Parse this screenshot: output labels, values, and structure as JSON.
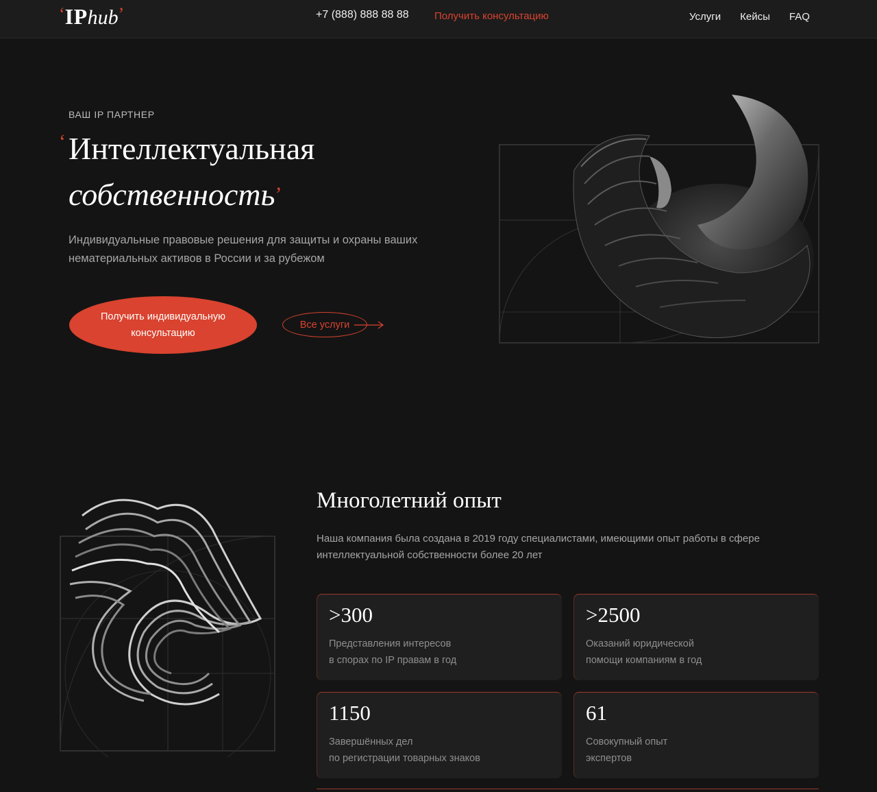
{
  "header": {
    "logo": {
      "quote_open": "‘",
      "ip": "IP",
      "hub": "hub",
      "quote_close": "’"
    },
    "phone": "+7 (888) 888 88 88",
    "cta": "Получить консультацию",
    "nav": [
      "Услуги",
      "Кейсы",
      "FAQ"
    ]
  },
  "hero": {
    "eyebrow": "ВАШ IP ПАРТНЕР",
    "title_line1": "Интеллектуальная",
    "title_line2": "собственность",
    "quote_open": "‘",
    "quote_close": "’",
    "subtitle": "Индивидуальные правовые решения для защиты и охраны ваших нематериальных активов в России и за рубежом",
    "primary_button": "Получить индивидуальную консультацию",
    "secondary_button": "Все услуги"
  },
  "experience": {
    "title": "Многолетний опыт",
    "subtitle": "Наша компания была создана в 2019 году специалистами, имеющими опыт работы в сфере интеллектуальной собственности более 20 лет",
    "stats": [
      {
        "value": ">300",
        "line1": "Представления интересов",
        "line2": "в спорах по IP правам в год"
      },
      {
        "value": ">2500",
        "line1": "Оказаний юридической",
        "line2": "помощи компаниям в год"
      },
      {
        "value": "1150",
        "line1": "Завершённых дел",
        "line2": "по регистрации товарных знаков"
      },
      {
        "value": "61",
        "line1": "Совокупный опыт",
        "line2": "экспертов"
      }
    ]
  },
  "colors": {
    "accent": "#d9432f",
    "background": "#141414",
    "card": "#1f1f1f"
  }
}
